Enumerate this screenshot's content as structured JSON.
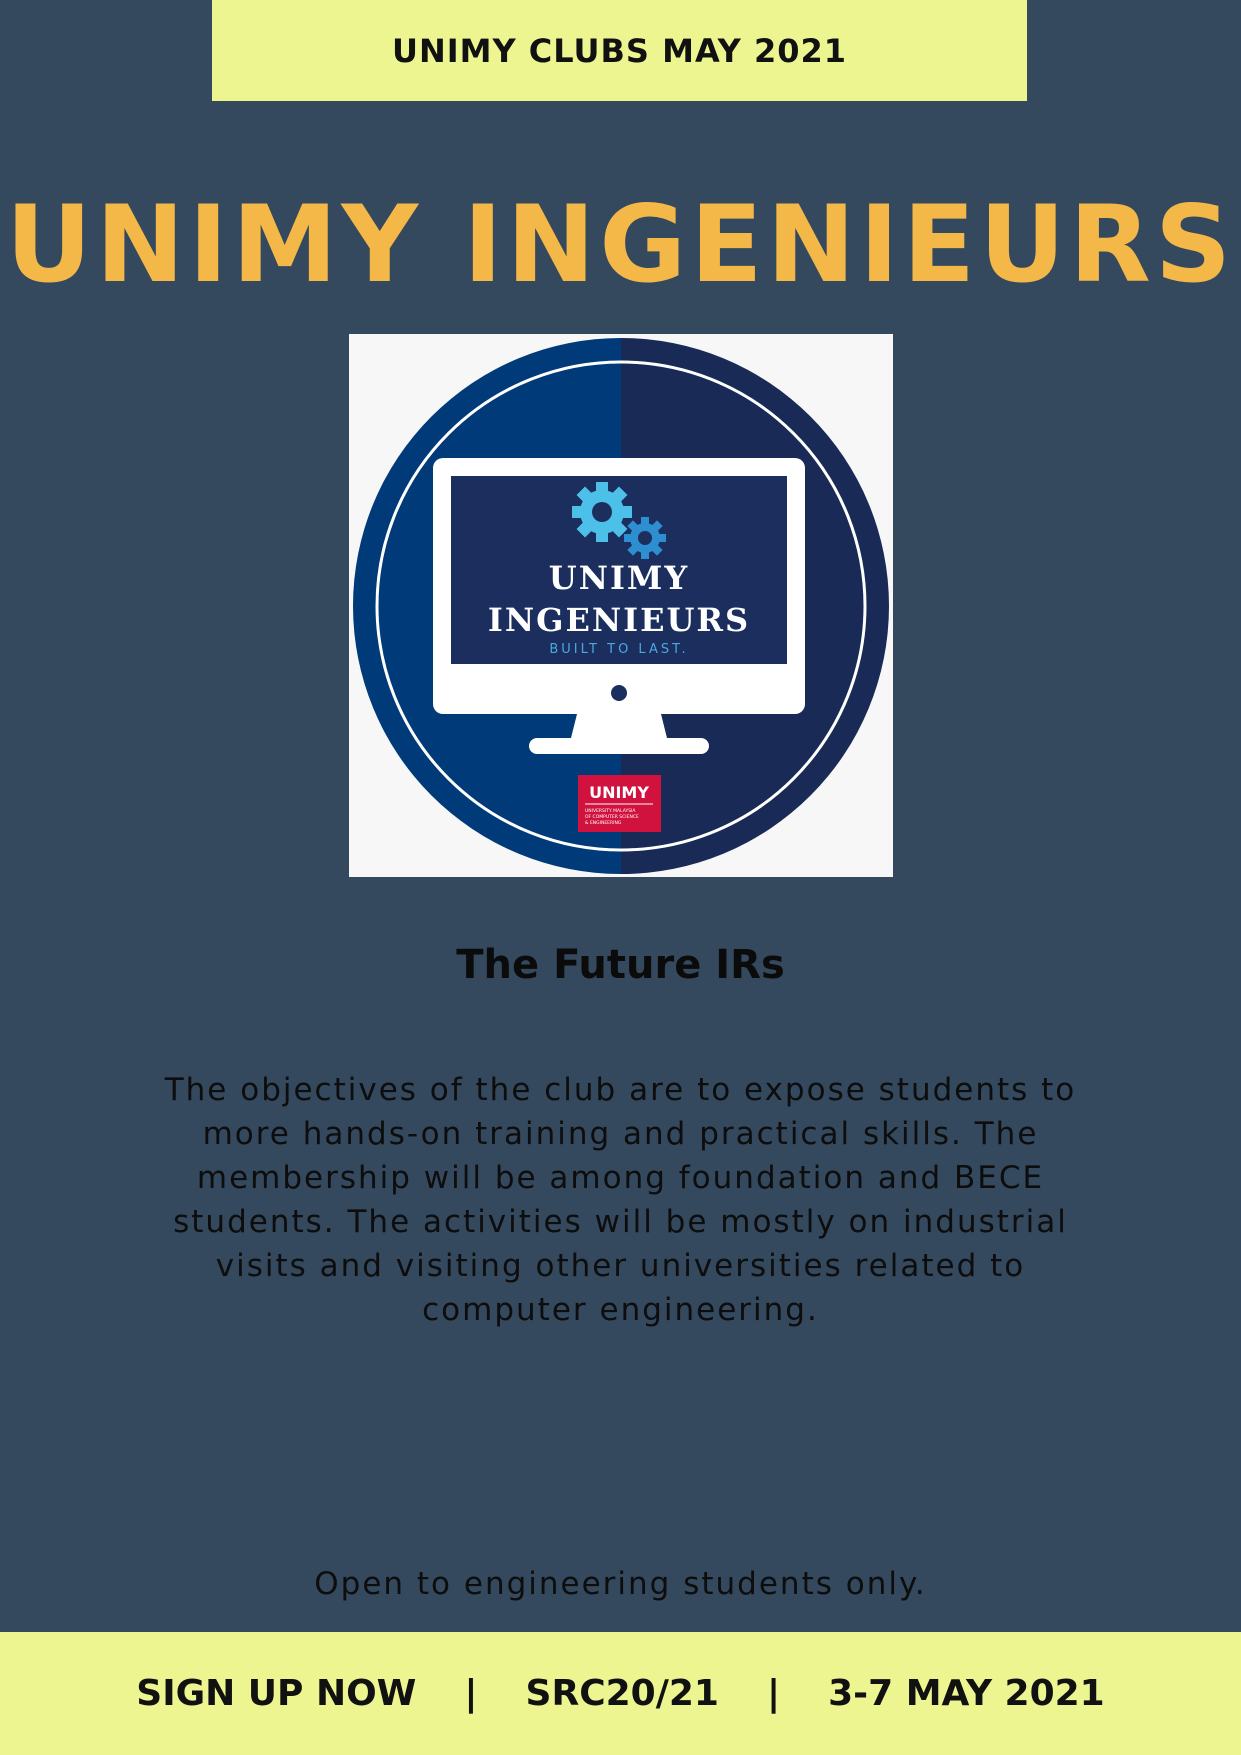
{
  "header": {
    "banner_text": "UNIMY CLUBS MAY 2021"
  },
  "title": "UNIMY INGENIEURS",
  "logo": {
    "line1": "UNIMY",
    "line2": "INGENIEURS",
    "tagline": "BUILT TO LAST.",
    "badge_text": "UNIMY",
    "badge_sub1": "UNIVERSITY MALAYSIA",
    "badge_sub2": "OF COMPUTER SCIENCE",
    "badge_sub3": "& ENGINEERING",
    "icon": "gears-icon",
    "colors": {
      "circle_left": "#003a78",
      "circle_right": "#182a55",
      "screen": "#1b2e5e",
      "gear_light": "#4cc0e8",
      "gear_mid": "#2e8fd0",
      "tagline": "#4aa8e0",
      "badge": "#d1123f"
    }
  },
  "subtitle": "The Future IRs",
  "description": "The objectives of the club are to expose students to more hands-on training and practical skills. The membership will be among foundation and BECE students. The activities will be mostly on industrial visits and visiting other universities related to computer engineering.",
  "open_note": "Open to engineering students only.",
  "footer": {
    "signup": "SIGN UP NOW",
    "separator": "|",
    "code": "SRC20/21",
    "dates": "3-7 MAY 2021"
  },
  "colors": {
    "background": "#34495e",
    "banner": "#edf591",
    "title": "#f3b847"
  }
}
